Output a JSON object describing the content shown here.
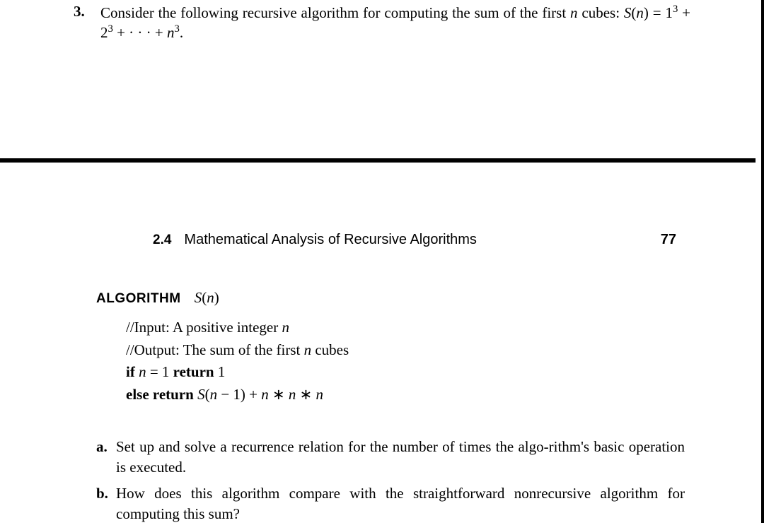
{
  "problem": {
    "number": "3.",
    "text_before_formula": "Consider the following recursive algorithm for computing the sum of the first ",
    "n_word": "n",
    "cubes_word": " cubes: ",
    "formula_lhs_S": "S",
    "formula_lhs_n": "n",
    "formula_eq": ") = 1",
    "exp3_a": "3",
    "plus2": " + 2",
    "exp3_b": "3",
    "plus_dots": " + · · · + ",
    "formula_n2": "n",
    "exp3_c": "3",
    "period": "."
  },
  "header": {
    "section_num": "2.4",
    "section_title": "Mathematical Analysis of Recursive Algorithms",
    "page_num": "77"
  },
  "algorithm": {
    "label": "ALGORITHM",
    "name_S": "S",
    "name_n": "n",
    "input_prefix": "//Input: A positive integer ",
    "input_n": "n",
    "output_prefix": "//Output: The sum of the first ",
    "output_n": "n",
    "output_suffix": " cubes",
    "if_kw": "if ",
    "if_n": "n",
    "if_eq": " = 1 ",
    "return_kw": "return",
    "return_1": " 1",
    "else_kw": "else return ",
    "else_S": "S",
    "else_arg_n": "n",
    "else_minus": " − 1) + ",
    "else_n1": "n",
    "else_star1": " ∗ ",
    "else_n2": "n",
    "else_star2": " ∗ ",
    "else_n3": "n"
  },
  "subparts": {
    "a_label": "a.",
    "a_text": "Set up and solve a recurrence relation for the number of times the algo-rithm's basic operation is executed.",
    "b_label": "b.",
    "b_text": "How does this algorithm compare with the straightforward nonrecursive algorithm for computing this sum?"
  }
}
